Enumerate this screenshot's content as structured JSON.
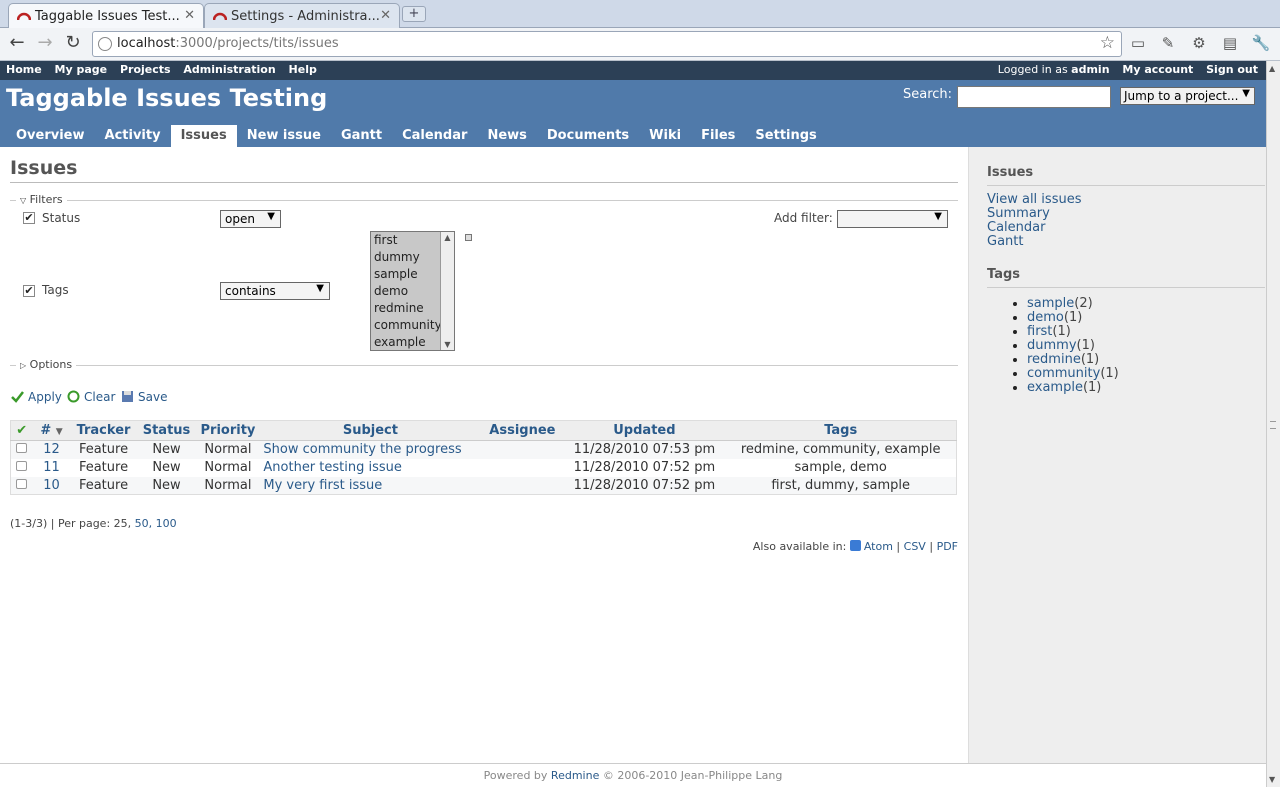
{
  "browser": {
    "tabs": [
      {
        "title": "Taggable Issues Test..."
      },
      {
        "title": "Settings - Administra..."
      }
    ],
    "url_host": "localhost",
    "url_path": ":3000/projects/tits/issues"
  },
  "top_menu": {
    "left": [
      "Home",
      "My page",
      "Projects",
      "Administration",
      "Help"
    ],
    "logged_in_as": "Logged in as",
    "user": "admin",
    "my_account": "My account",
    "sign_out": "Sign out"
  },
  "header": {
    "title": "Taggable Issues Testing",
    "search_label": "Search:",
    "jump_label": "Jump to a project..."
  },
  "main_menu": [
    "Overview",
    "Activity",
    "Issues",
    "New issue",
    "Gantt",
    "Calendar",
    "News",
    "Documents",
    "Wiki",
    "Files",
    "Settings"
  ],
  "main_menu_selected": "Issues",
  "content": {
    "title": "Issues",
    "filters_legend": "Filters",
    "status_label": "Status",
    "status_value": "open",
    "add_filter_label": "Add filter:",
    "tags_label": "Tags",
    "tags_operator": "contains",
    "tag_options": [
      "first",
      "dummy",
      "sample",
      "demo",
      "redmine",
      "community",
      "example"
    ],
    "options_legend": "Options",
    "apply": "Apply",
    "clear": "Clear",
    "save": "Save"
  },
  "table": {
    "headers": [
      "#",
      "Tracker",
      "Status",
      "Priority",
      "Subject",
      "Assignee",
      "Updated",
      "Tags"
    ],
    "rows": [
      {
        "id": "12",
        "tracker": "Feature",
        "status": "New",
        "priority": "Normal",
        "subject": "Show community the progress",
        "assignee": "",
        "updated": "11/28/2010 07:53 pm",
        "tags": "redmine, community, example"
      },
      {
        "id": "11",
        "tracker": "Feature",
        "status": "New",
        "priority": "Normal",
        "subject": "Another testing issue",
        "assignee": "",
        "updated": "11/28/2010 07:52 pm",
        "tags": "sample, demo"
      },
      {
        "id": "10",
        "tracker": "Feature",
        "status": "New",
        "priority": "Normal",
        "subject": "My very first issue",
        "assignee": "",
        "updated": "11/28/2010 07:52 pm",
        "tags": "first, dummy, sample"
      }
    ]
  },
  "pagination": {
    "range": "(1-3/3) | Per page:",
    "current": "25,",
    "opt50": "50,",
    "opt100": "100"
  },
  "formats": {
    "label": "Also available in:",
    "atom": "Atom",
    "sep": "|",
    "csv": "CSV",
    "pdf": "PDF"
  },
  "sidebar": {
    "issues_heading": "Issues",
    "issue_links": [
      "View all issues",
      "Summary",
      "Calendar",
      "Gantt"
    ],
    "tags_heading": "Tags",
    "tags": [
      {
        "name": "sample",
        "count": "(2)"
      },
      {
        "name": "demo",
        "count": "(1)"
      },
      {
        "name": "first",
        "count": "(1)"
      },
      {
        "name": "dummy",
        "count": "(1)"
      },
      {
        "name": "redmine",
        "count": "(1)"
      },
      {
        "name": "community",
        "count": "(1)"
      },
      {
        "name": "example",
        "count": "(1)"
      }
    ]
  },
  "footer": {
    "powered_by": "Powered by",
    "redmine": "Redmine",
    "copyright": "© 2006-2010 Jean-Philippe Lang"
  },
  "colors": {
    "header_bg": "#507aaa",
    "top_menu_bg": "#2c4056",
    "link": "#2a5a8a",
    "sidebar_bg": "#eeeeee"
  }
}
